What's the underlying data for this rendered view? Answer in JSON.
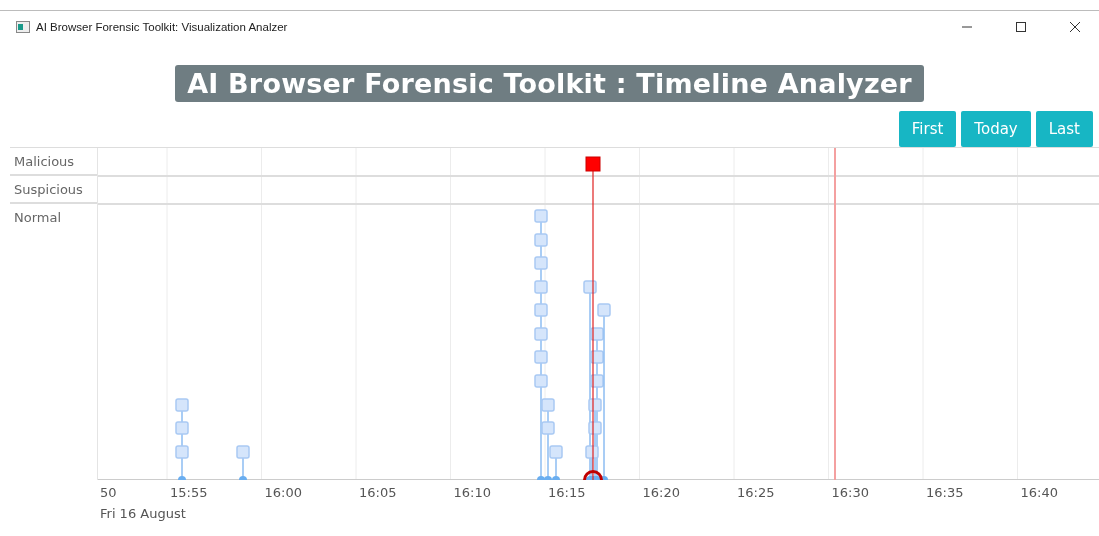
{
  "window": {
    "title": "AI Browser Forensic Toolkit: Visualization Analzer"
  },
  "heading": "AI Browser Forensic Toolkit : Timeline Analyzer",
  "buttons": [
    "First",
    "Today",
    "Last"
  ],
  "groups": [
    "Malicious",
    "Suspicious",
    "Normal"
  ],
  "axis": {
    "ticks": [
      "50",
      "15:55",
      "16:00",
      "16:05",
      "16:10",
      "16:15",
      "16:20",
      "16:25",
      "16:30",
      "16:35",
      "16:40"
    ],
    "date": "Fri 16 August"
  }
}
